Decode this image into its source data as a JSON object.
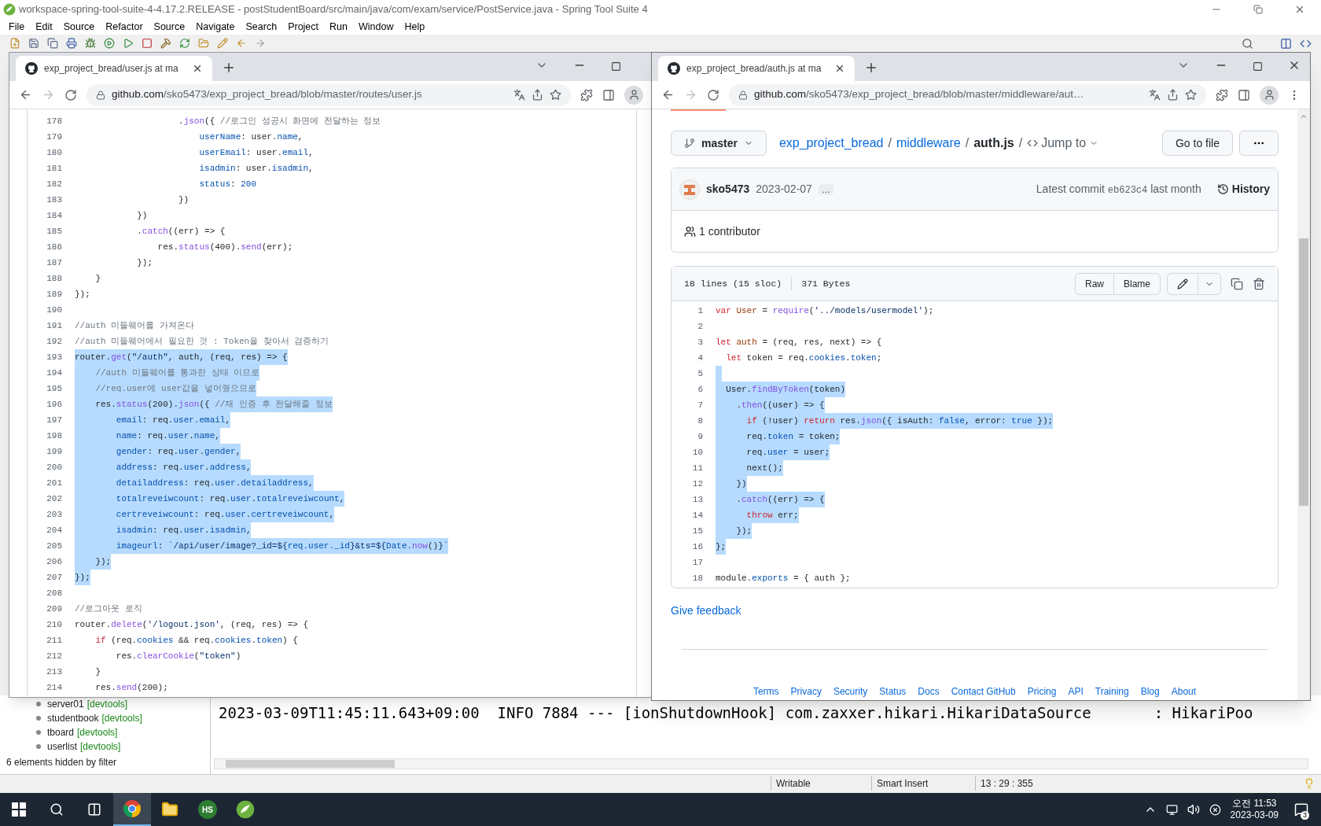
{
  "ide": {
    "title": "workspace-spring-tool-suite-4-4.17.2.RELEASE - postStudentBoard/src/main/java/com/exam/service/PostService.java - Spring Tool Suite 4",
    "menu": [
      "File",
      "Edit",
      "Source",
      "Refactor",
      "Source",
      "Navigate",
      "Search",
      "Project",
      "Run",
      "Window",
      "Help"
    ],
    "status_bar": [
      "Writable",
      "Smart Insert",
      "13 : 29 : 355"
    ]
  },
  "left_browser": {
    "tab_title": "exp_project_bread/user.js at ma",
    "url_host": "github.com",
    "url_path": "/sko5473/exp_project_bread/blob/master/routes/user.js",
    "code_lines": [
      {
        "number": "178",
        "selected": false,
        "tokens": [
          {
            "text": "                    .",
            "kind": "txt"
          },
          {
            "text": "json",
            "kind": "fn"
          },
          {
            "text": "({ ",
            "kind": "txt"
          },
          {
            "text": "//로그인 성공시 화면에 전달하는 정보",
            "kind": "com"
          }
        ]
      },
      {
        "number": "179",
        "selected": false,
        "tokens": [
          {
            "text": "                        userName",
            "kind": "prop"
          },
          {
            "text": ": user.",
            "kind": "txt"
          },
          {
            "text": "name",
            "kind": "prop"
          },
          {
            "text": ",",
            "kind": "txt"
          }
        ]
      },
      {
        "number": "180",
        "selected": false,
        "tokens": [
          {
            "text": "                        userEmail",
            "kind": "prop"
          },
          {
            "text": ": user.",
            "kind": "txt"
          },
          {
            "text": "email",
            "kind": "prop"
          },
          {
            "text": ",",
            "kind": "txt"
          }
        ]
      },
      {
        "number": "181",
        "selected": false,
        "tokens": [
          {
            "text": "                        isadmin",
            "kind": "prop"
          },
          {
            "text": ": user.",
            "kind": "txt"
          },
          {
            "text": "isadmin",
            "kind": "prop"
          },
          {
            "text": ",",
            "kind": "txt"
          }
        ]
      },
      {
        "number": "182",
        "selected": false,
        "tokens": [
          {
            "text": "                        status",
            "kind": "prop"
          },
          {
            "text": ": ",
            "kind": "txt"
          },
          {
            "text": "200",
            "kind": "num"
          }
        ]
      },
      {
        "number": "183",
        "selected": false,
        "tokens": [
          {
            "text": "                    })",
            "kind": "txt"
          }
        ]
      },
      {
        "number": "184",
        "selected": false,
        "tokens": [
          {
            "text": "            })",
            "kind": "txt"
          }
        ]
      },
      {
        "number": "185",
        "selected": false,
        "tokens": [
          {
            "text": "            .",
            "kind": "txt"
          },
          {
            "text": "catch",
            "kind": "fn"
          },
          {
            "text": "((err) => {",
            "kind": "txt"
          }
        ]
      },
      {
        "number": "186",
        "selected": false,
        "tokens": [
          {
            "text": "                res.",
            "kind": "txt"
          },
          {
            "text": "status",
            "kind": "fn"
          },
          {
            "text": "(400).",
            "kind": "txt"
          },
          {
            "text": "send",
            "kind": "fn"
          },
          {
            "text": "(err);",
            "kind": "txt"
          }
        ]
      },
      {
        "number": "187",
        "selected": false,
        "tokens": [
          {
            "text": "            });",
            "kind": "txt"
          }
        ]
      },
      {
        "number": "188",
        "selected": false,
        "tokens": [
          {
            "text": "    }",
            "kind": "txt"
          }
        ]
      },
      {
        "number": "189",
        "selected": false,
        "tokens": [
          {
            "text": "});",
            "kind": "txt"
          }
        ]
      },
      {
        "number": "190",
        "selected": false
      },
      {
        "number": "191",
        "selected": false,
        "tokens": [
          {
            "text": "//auth 미들웨어를 가져온다",
            "kind": "com"
          }
        ]
      },
      {
        "number": "192",
        "selected": false,
        "tokens": [
          {
            "text": "//auth 미들웨어에서 필요한 것 : Token을 찾아서 검증하기",
            "kind": "com"
          }
        ]
      },
      {
        "number": "193",
        "selected": true,
        "tokens": [
          {
            "text": "router.",
            "kind": "txt"
          },
          {
            "text": "get",
            "kind": "fn"
          },
          {
            "text": "(",
            "kind": "txt"
          },
          {
            "text": "\"/auth\"",
            "kind": "str"
          },
          {
            "text": ", auth, (req, res) => {",
            "kind": "txt"
          }
        ]
      },
      {
        "number": "194",
        "selected": true,
        "tokens": [
          {
            "text": "    //auth 미들웨어를 통과한 상태 이므로",
            "kind": "com"
          }
        ]
      },
      {
        "number": "195",
        "selected": true,
        "tokens": [
          {
            "text": "    //req.user에 user값을 넣어줬으므로",
            "kind": "com"
          }
        ]
      },
      {
        "number": "196",
        "selected": true,
        "tokens": [
          {
            "text": "    res.",
            "kind": "txt"
          },
          {
            "text": "status",
            "kind": "fn"
          },
          {
            "text": "(200).",
            "kind": "txt"
          },
          {
            "text": "json",
            "kind": "fn"
          },
          {
            "text": "({ ",
            "kind": "txt"
          },
          {
            "text": "//재 인증 후 전달해줄 정보",
            "kind": "com"
          }
        ]
      },
      {
        "number": "197",
        "selected": true,
        "tokens": [
          {
            "text": "        email",
            "kind": "prop"
          },
          {
            "text": ": req.",
            "kind": "txt"
          },
          {
            "text": "user",
            "kind": "prop"
          },
          {
            "text": ".",
            "kind": "txt"
          },
          {
            "text": "email",
            "kind": "prop"
          },
          {
            "text": ",",
            "kind": "txt"
          }
        ]
      },
      {
        "number": "198",
        "selected": true,
        "tokens": [
          {
            "text": "        name",
            "kind": "prop"
          },
          {
            "text": ": req.",
            "kind": "txt"
          },
          {
            "text": "user",
            "kind": "prop"
          },
          {
            "text": ".",
            "kind": "txt"
          },
          {
            "text": "name",
            "kind": "prop"
          },
          {
            "text": ",",
            "kind": "txt"
          }
        ]
      },
      {
        "number": "199",
        "selected": true,
        "tokens": [
          {
            "text": "        gender",
            "kind": "prop"
          },
          {
            "text": ": req.",
            "kind": "txt"
          },
          {
            "text": "user",
            "kind": "prop"
          },
          {
            "text": ".",
            "kind": "txt"
          },
          {
            "text": "gender",
            "kind": "prop"
          },
          {
            "text": ",",
            "kind": "txt"
          }
        ]
      },
      {
        "number": "200",
        "selected": true,
        "tokens": [
          {
            "text": "        address",
            "kind": "prop"
          },
          {
            "text": ": req.",
            "kind": "txt"
          },
          {
            "text": "user",
            "kind": "prop"
          },
          {
            "text": ".",
            "kind": "txt"
          },
          {
            "text": "address",
            "kind": "prop"
          },
          {
            "text": ",",
            "kind": "txt"
          }
        ]
      },
      {
        "number": "201",
        "selected": true,
        "tokens": [
          {
            "text": "        detailaddress",
            "kind": "prop"
          },
          {
            "text": ": req.",
            "kind": "txt"
          },
          {
            "text": "user",
            "kind": "prop"
          },
          {
            "text": ".",
            "kind": "txt"
          },
          {
            "text": "detailaddress",
            "kind": "prop"
          },
          {
            "text": ",",
            "kind": "txt"
          }
        ]
      },
      {
        "number": "202",
        "selected": true,
        "tokens": [
          {
            "text": "        totalreveiwcount",
            "kind": "prop"
          },
          {
            "text": ": req.",
            "kind": "txt"
          },
          {
            "text": "user",
            "kind": "prop"
          },
          {
            "text": ".",
            "kind": "txt"
          },
          {
            "text": "totalreveiwcount",
            "kind": "prop"
          },
          {
            "text": ",",
            "kind": "txt"
          }
        ]
      },
      {
        "number": "203",
        "selected": true,
        "tokens": [
          {
            "text": "        certreveiwcount",
            "kind": "prop"
          },
          {
            "text": ": req.",
            "kind": "txt"
          },
          {
            "text": "user",
            "kind": "prop"
          },
          {
            "text": ".",
            "kind": "txt"
          },
          {
            "text": "certreveiwcount",
            "kind": "prop"
          },
          {
            "text": ",",
            "kind": "txt"
          }
        ]
      },
      {
        "number": "204",
        "selected": true,
        "tokens": [
          {
            "text": "        isadmin",
            "kind": "prop"
          },
          {
            "text": ": req.",
            "kind": "txt"
          },
          {
            "text": "user",
            "kind": "prop"
          },
          {
            "text": ".",
            "kind": "txt"
          },
          {
            "text": "isadmin",
            "kind": "prop"
          },
          {
            "text": ",",
            "kind": "txt"
          }
        ]
      },
      {
        "number": "205",
        "selected": true,
        "tokens": [
          {
            "text": "        imageurl",
            "kind": "prop"
          },
          {
            "text": ": ",
            "kind": "txt"
          },
          {
            "text": "`/api/user/image?_id=${",
            "kind": "str"
          },
          {
            "text": "req.user._id",
            "kind": "prop"
          },
          {
            "text": "}&ts=${",
            "kind": "str"
          },
          {
            "text": "Date.",
            "kind": "prop"
          },
          {
            "text": "now",
            "kind": "fn"
          },
          {
            "text": "()",
            "kind": "txt"
          },
          {
            "text": "}`",
            "kind": "str"
          }
        ]
      },
      {
        "number": "206",
        "selected": true,
        "tokens": [
          {
            "text": "    });",
            "kind": "txt"
          }
        ]
      },
      {
        "number": "207",
        "selected": true,
        "tokens": [
          {
            "text": "});",
            "kind": "txt"
          }
        ]
      },
      {
        "number": "208",
        "selected": false
      },
      {
        "number": "209",
        "selected": false,
        "tokens": [
          {
            "text": "//로그아웃 로직",
            "kind": "com"
          }
        ]
      },
      {
        "number": "210",
        "selected": false,
        "tokens": [
          {
            "text": "router.",
            "kind": "txt"
          },
          {
            "text": "delete",
            "kind": "fn"
          },
          {
            "text": "(",
            "kind": "txt"
          },
          {
            "text": "'/logout.json'",
            "kind": "str"
          },
          {
            "text": ", (req, res) => {",
            "kind": "txt"
          }
        ]
      },
      {
        "number": "211",
        "selected": false,
        "tokens": [
          {
            "text": "    if",
            "kind": "kw"
          },
          {
            "text": " (req.",
            "kind": "txt"
          },
          {
            "text": "cookies",
            "kind": "prop"
          },
          {
            "text": " && req.",
            "kind": "txt"
          },
          {
            "text": "cookies",
            "kind": "prop"
          },
          {
            "text": ".",
            "kind": "txt"
          },
          {
            "text": "token",
            "kind": "prop"
          },
          {
            "text": ") {",
            "kind": "txt"
          }
        ]
      },
      {
        "number": "212",
        "selected": false,
        "tokens": [
          {
            "text": "        res.",
            "kind": "txt"
          },
          {
            "text": "clearCookie",
            "kind": "fn"
          },
          {
            "text": "(",
            "kind": "txt"
          },
          {
            "text": "\"token\"",
            "kind": "str"
          },
          {
            "text": ")",
            "kind": "txt"
          }
        ]
      },
      {
        "number": "213",
        "selected": false,
        "tokens": [
          {
            "text": "    }",
            "kind": "txt"
          }
        ]
      },
      {
        "number": "214",
        "selected": false,
        "tokens": [
          {
            "text": "    res.",
            "kind": "txt"
          },
          {
            "text": "send",
            "kind": "fn"
          },
          {
            "text": "(200);",
            "kind": "txt"
          }
        ]
      }
    ]
  },
  "right_browser": {
    "tab_title": "exp_project_bread/auth.js at ma",
    "url_host": "github.com",
    "url_path": "/sko5473/exp_project_bread/blob/master/middleware/aut…",
    "branch": "master",
    "breadcrumb": [
      {
        "text": "exp_project_bread",
        "kind": "link"
      },
      {
        "text": "/",
        "kind": "sep"
      },
      {
        "text": "middleware",
        "kind": "link"
      },
      {
        "text": "/",
        "kind": "sep"
      },
      {
        "text": "auth.js",
        "kind": "current"
      },
      {
        "text": "/",
        "kind": "sep"
      }
    ],
    "jump_to": "Jump to",
    "go_to_file": "Go to file",
    "commit": {
      "author": "sko5473",
      "date": "2023-02-07",
      "more": "…",
      "label": "Latest commit",
      "sha": "eb623c4",
      "when": "last month",
      "history": "History"
    },
    "contributors": "1 contributor",
    "file_info": [
      "18 lines (15 sloc)",
      "371 Bytes"
    ],
    "file_buttons": [
      "Raw",
      "Blame"
    ],
    "code_lines": [
      {
        "number": "1",
        "selected": false,
        "tokens": [
          {
            "text": "var ",
            "kind": "kw"
          },
          {
            "text": "User",
            "kind": "var"
          },
          {
            "text": " = ",
            "kind": "txt"
          },
          {
            "text": "require",
            "kind": "fn"
          },
          {
            "text": "(",
            "kind": "txt"
          },
          {
            "text": "'../models/usermodel'",
            "kind": "str"
          },
          {
            "text": ");",
            "kind": "txt"
          }
        ]
      },
      {
        "number": "2",
        "selected": false
      },
      {
        "number": "3",
        "selected": false,
        "tokens": [
          {
            "text": "let ",
            "kind": "kw"
          },
          {
            "text": "auth",
            "kind": "var"
          },
          {
            "text": " = (req, res, next) => {",
            "kind": "txt"
          }
        ]
      },
      {
        "number": "4",
        "selected": false,
        "tokens": [
          {
            "text": "  let",
            "kind": "kw"
          },
          {
            "text": " token = req.",
            "kind": "txt"
          },
          {
            "text": "cookies",
            "kind": "prop"
          },
          {
            "text": ".",
            "kind": "txt"
          },
          {
            "text": "token",
            "kind": "prop"
          },
          {
            "text": ";",
            "kind": "txt"
          }
        ]
      },
      {
        "number": "5",
        "selected": true
      },
      {
        "number": "6",
        "selected": true,
        "tokens": [
          {
            "text": "  User.",
            "kind": "txt"
          },
          {
            "text": "findByToken",
            "kind": "fn"
          },
          {
            "text": "(token)",
            "kind": "txt"
          }
        ]
      },
      {
        "number": "7",
        "selected": true,
        "tokens": [
          {
            "text": "    .",
            "kind": "txt"
          },
          {
            "text": "then",
            "kind": "fn"
          },
          {
            "text": "((user) => {",
            "kind": "txt"
          }
        ]
      },
      {
        "number": "8",
        "selected": true,
        "tokens": [
          {
            "text": "      if",
            "kind": "kw"
          },
          {
            "text": " (!user) ",
            "kind": "txt"
          },
          {
            "text": "return",
            "kind": "kw"
          },
          {
            "text": " res.",
            "kind": "txt"
          },
          {
            "text": "json",
            "kind": "fn"
          },
          {
            "text": "({ isAuth: ",
            "kind": "txt"
          },
          {
            "text": "false",
            "kind": "prop"
          },
          {
            "text": ", error: ",
            "kind": "txt"
          },
          {
            "text": "true",
            "kind": "prop"
          },
          {
            "text": " });",
            "kind": "txt"
          }
        ]
      },
      {
        "number": "9",
        "selected": true,
        "tokens": [
          {
            "text": "      req.",
            "kind": "txt"
          },
          {
            "text": "token",
            "kind": "prop"
          },
          {
            "text": " = token;",
            "kind": "txt"
          }
        ]
      },
      {
        "number": "10",
        "selected": true,
        "tokens": [
          {
            "text": "      req.",
            "kind": "txt"
          },
          {
            "text": "user",
            "kind": "prop"
          },
          {
            "text": " = user;",
            "kind": "txt"
          }
        ]
      },
      {
        "number": "11",
        "selected": true,
        "tokens": [
          {
            "text": "      next();",
            "kind": "txt"
          }
        ]
      },
      {
        "number": "12",
        "selected": true,
        "tokens": [
          {
            "text": "    })",
            "kind": "txt"
          }
        ]
      },
      {
        "number": "13",
        "selected": true,
        "tokens": [
          {
            "text": "    .",
            "kind": "txt"
          },
          {
            "text": "catch",
            "kind": "fn"
          },
          {
            "text": "((err) => {",
            "kind": "txt"
          }
        ]
      },
      {
        "number": "14",
        "selected": true,
        "tokens": [
          {
            "text": "      throw",
            "kind": "kw"
          },
          {
            "text": " err;",
            "kind": "txt"
          }
        ]
      },
      {
        "number": "15",
        "selected": true,
        "tokens": [
          {
            "text": "    });",
            "kind": "txt"
          }
        ]
      },
      {
        "number": "16",
        "selected": true,
        "tokens": [
          {
            "text": "};",
            "kind": "txt"
          }
        ]
      },
      {
        "number": "17",
        "selected": false
      },
      {
        "number": "18",
        "selected": false,
        "tokens": [
          {
            "text": "module.",
            "kind": "txt"
          },
          {
            "text": "exports",
            "kind": "prop"
          },
          {
            "text": " = { auth };",
            "kind": "txt"
          }
        ]
      }
    ],
    "feedback": "Give feedback",
    "footer_links": [
      "Terms",
      "Privacy",
      "Security",
      "Status",
      "Docs",
      "Contact GitHub",
      "Pricing",
      "API",
      "Training",
      "Blog",
      "About"
    ]
  },
  "servers_panel": {
    "items": [
      {
        "name": "server01",
        "tag": "[devtools]"
      },
      {
        "name": "studentbook",
        "tag": "[devtools]"
      },
      {
        "name": "tboard",
        "tag": "[devtools]"
      },
      {
        "name": "userlist",
        "tag": "[devtools]"
      }
    ],
    "filter_note": "6 elements hidden by filter"
  },
  "console": {
    "lines": [
      "2023-03-09T11:45:11.643+09:00  INFO 7884 --- [ionShutdownHook] com.zaxxer.hikari.HikariDataSource       : HikariPoo"
    ]
  },
  "taskbar": {
    "apps": [
      {
        "kind": "windows"
      },
      {
        "kind": "search"
      },
      {
        "kind": "taskview"
      },
      {
        "kind": "browser",
        "selected": true
      },
      {
        "kind": "folder",
        "selected": false
      },
      {
        "kind": "hs",
        "label": "HS",
        "selected": false
      },
      {
        "kind": "leaf",
        "selected": false
      }
    ],
    "time": "오전 11:53",
    "date": "2023-03-09",
    "notifications": "3"
  }
}
